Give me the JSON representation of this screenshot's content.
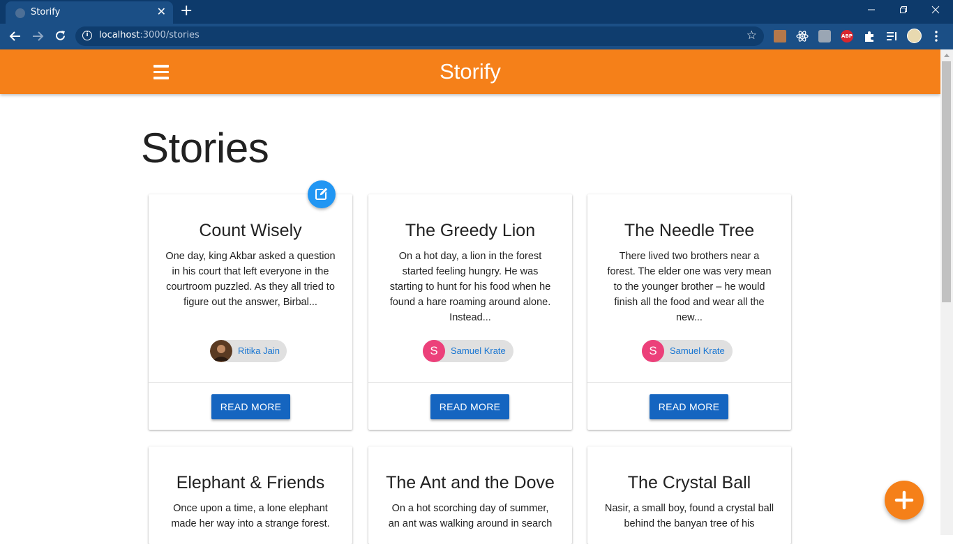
{
  "browser": {
    "tab_title": "Storify",
    "new_tab": "+",
    "url_host": "localhost",
    "url_path": ":3000/stories",
    "window_controls": [
      "minimize-icon",
      "restore-icon",
      "close-icon"
    ]
  },
  "app": {
    "brand": "Storify",
    "accent_color": "#f58019",
    "primary_button_color": "#1565c0"
  },
  "page": {
    "heading": "Stories"
  },
  "stories": [
    {
      "title": "Count Wisely",
      "excerpt": "One day, king Akbar asked a question in his court that left everyone in the courtroom puzzled. As they all tried to figure out the answer, Birbal...",
      "author": "Ritika Jain",
      "avatar_initial": "",
      "avatar_color": "#5a3a22",
      "button": "READ MORE"
    },
    {
      "title": "The Greedy Lion",
      "excerpt": "On a hot day, a lion in the forest started feeling hungry. He was starting to hunt for his food when he found a hare roaming around alone. Instead...",
      "author": "Samuel Krate",
      "avatar_initial": "S",
      "avatar_color": "#ec407a",
      "button": "READ MORE"
    },
    {
      "title": "The Needle Tree",
      "excerpt": "There lived two brothers near a forest. The elder one was very mean to the younger brother – he would finish all the food and wear all the new...",
      "author": "Samuel Krate",
      "avatar_initial": "S",
      "avatar_color": "#ec407a",
      "button": "READ MORE"
    },
    {
      "title": "Elephant & Friends",
      "excerpt": "Once upon a time, a lone elephant made her way into a strange forest."
    },
    {
      "title": "The Ant and the Dove",
      "excerpt": "On a hot scorching day of summer, an ant was walking around in search"
    },
    {
      "title": "The Crystal Ball",
      "excerpt": "Nasir, a small boy, found a crystal ball behind the banyan tree of his"
    }
  ]
}
